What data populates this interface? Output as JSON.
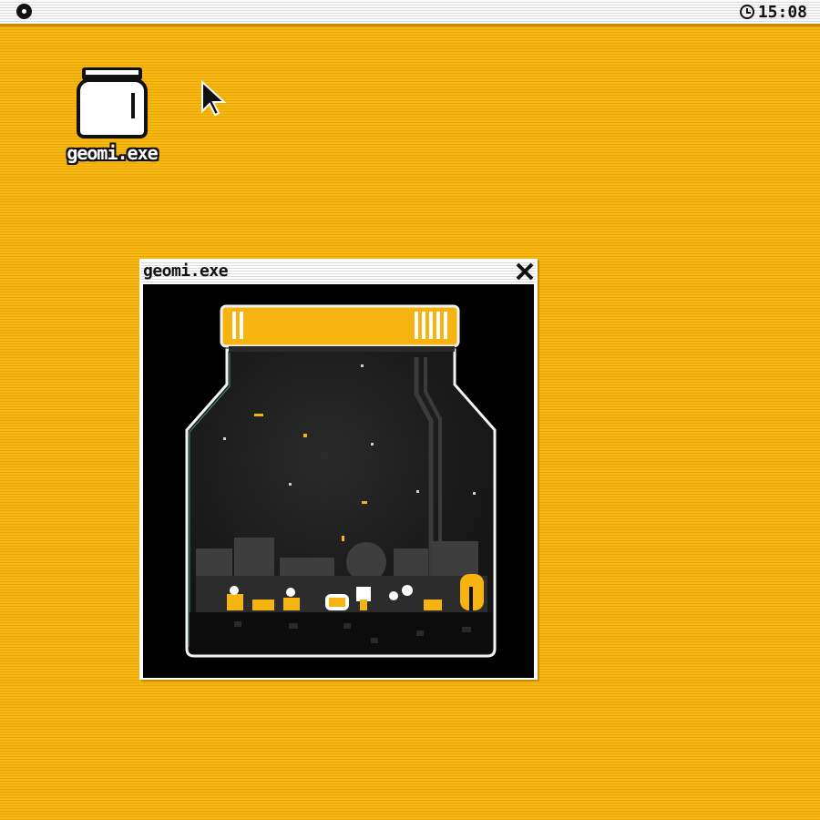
{
  "menubar": {
    "logo_icon": "circle-logo-icon",
    "clock_icon": "clock-icon",
    "time": "15:08"
  },
  "desktop": {
    "icons": [
      {
        "label": "geomi.exe",
        "icon": "jar-icon"
      }
    ],
    "cursor_icon": "arrow-cursor-icon",
    "background_color": "#f4b20e"
  },
  "window": {
    "title": "geomi.exe",
    "close_icon": "close-x-icon",
    "accent_color": "#f7b411"
  }
}
